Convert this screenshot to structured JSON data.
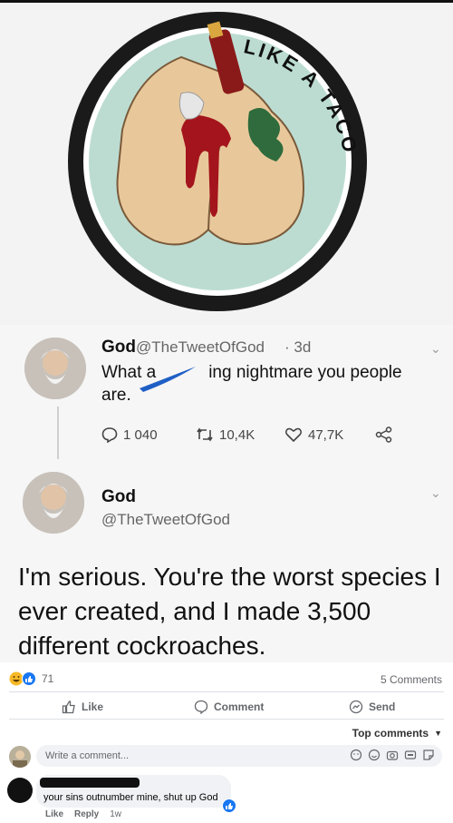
{
  "patch": {
    "arc_text": "LIKE A TACO"
  },
  "tweet1": {
    "name": "God",
    "handle": "@TheTweetOfGod",
    "age": "· 3d",
    "text_part1": "What a",
    "text_part2": "ing nightmare you people",
    "text_part3": "are.",
    "replies": "1 040",
    "retweets": "10,4K",
    "likes": "47,7K"
  },
  "tweet2": {
    "name": "God",
    "handle": "@TheTweetOfGod",
    "text": "I'm serious. You're the worst species I ever created, and I made 3,500 different cockroaches."
  },
  "facebook": {
    "reaction_count": "71",
    "comments_count": "5 Comments",
    "like_label": "Like",
    "comment_label": "Comment",
    "send_label": "Send",
    "sort_label": "Top comments",
    "write_placeholder": "Write a comment...",
    "comment_text": "your sins outnumber mine, shut up God",
    "comment_like": "Like",
    "comment_reply": "Reply",
    "comment_time": "1w",
    "colors": {
      "like_blue": "#1877f2",
      "haha_yellow": "#f7b928",
      "text_gray": "#65676b"
    }
  }
}
